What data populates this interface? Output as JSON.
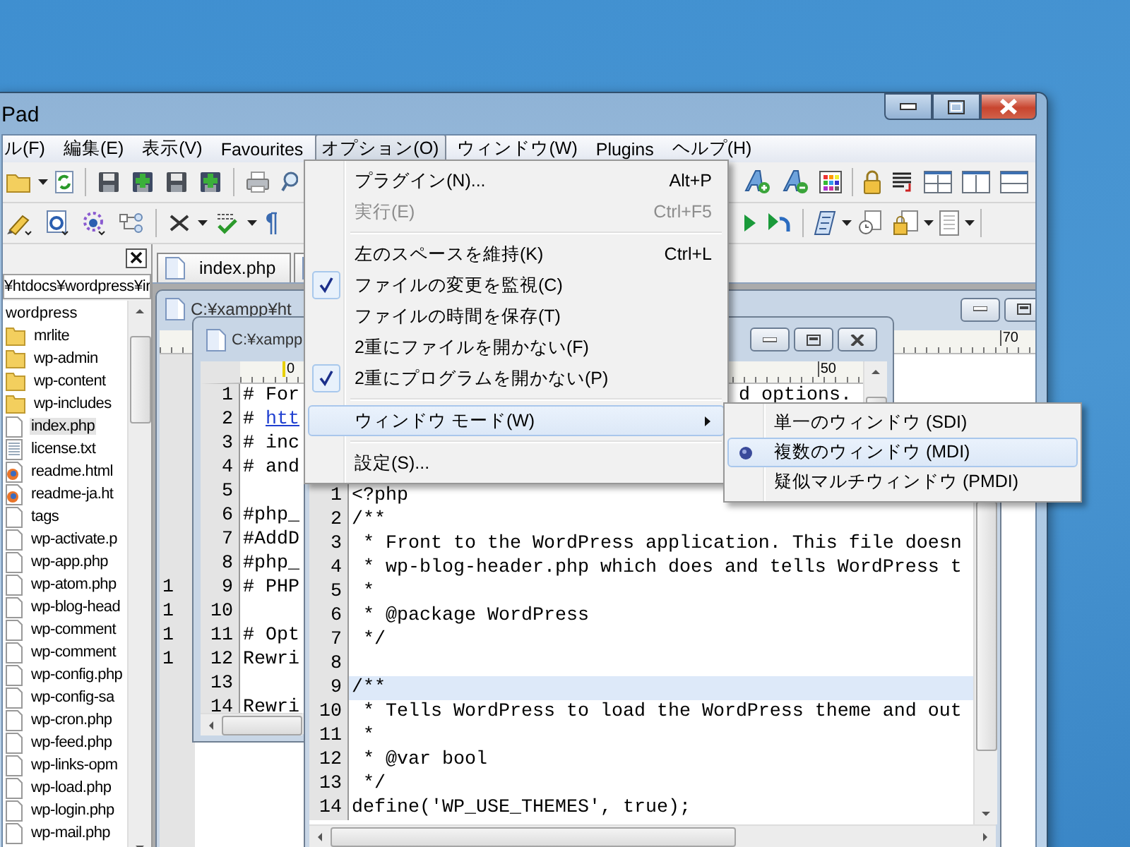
{
  "window": {
    "title": "Pad"
  },
  "menu_bar": [
    {
      "label": "ル(F)",
      "selected": false
    },
    {
      "label": "編集(E)",
      "selected": false
    },
    {
      "label": "表示(V)",
      "selected": false
    },
    {
      "label": "Favourites",
      "selected": false
    },
    {
      "label": "オプション(O)",
      "selected": true
    },
    {
      "label": "ウィンドウ(W)",
      "selected": false
    },
    {
      "label": "Plugins",
      "selected": false
    },
    {
      "label": "ヘルプ(H)",
      "selected": false
    }
  ],
  "options_menu": {
    "groups": [
      [
        {
          "label": "プラグイン(N)...",
          "shortcut": "Alt+P",
          "kind": "item",
          "checked": false,
          "disabled": false,
          "selected": false
        },
        {
          "label": "実行(E)",
          "shortcut": "Ctrl+F5",
          "kind": "item",
          "checked": false,
          "disabled": true,
          "selected": false
        }
      ],
      [
        {
          "label": "左のスペースを維持(K)",
          "shortcut": "Ctrl+L",
          "kind": "item",
          "checked": false,
          "disabled": false,
          "selected": false
        },
        {
          "label": "ファイルの変更を監視(C)",
          "kind": "item",
          "checked": true,
          "disabled": false,
          "selected": false
        },
        {
          "label": "ファイルの時間を保存(T)",
          "kind": "item",
          "checked": false,
          "disabled": false,
          "selected": false
        },
        {
          "label": "2重にファイルを開かない(F)",
          "kind": "item",
          "checked": false,
          "disabled": false,
          "selected": false
        },
        {
          "label": "2重にプログラムを開かない(P)",
          "kind": "item",
          "checked": true,
          "disabled": false,
          "selected": false
        }
      ],
      [
        {
          "label": "ウィンドウ モード(W)",
          "kind": "submenu",
          "checked": false,
          "disabled": false,
          "selected": true
        }
      ],
      [
        {
          "label": "設定(S)...",
          "kind": "item",
          "checked": false,
          "disabled": false,
          "selected": false
        }
      ]
    ]
  },
  "window_mode_submenu": [
    {
      "label": "単一のウィンドウ (SDI)",
      "selected": false
    },
    {
      "label": "複数のウィンドウ (MDI)",
      "selected": true
    },
    {
      "label": "疑似マルチウィンドウ (PMDI)",
      "selected": false
    }
  ],
  "file_panel": {
    "path": "¥htdocs¥wordpress¥ir",
    "tree": [
      {
        "label": "wordpress",
        "selected": false,
        "children": [
          {
            "label": "mrlite",
            "kind": "folder",
            "selected": false
          },
          {
            "label": "wp-admin",
            "kind": "folder",
            "selected": false
          },
          {
            "label": "wp-content",
            "kind": "folder",
            "selected": false
          },
          {
            "label": "wp-includes",
            "kind": "folder",
            "selected": false
          },
          {
            "label": "index.php",
            "kind": "file",
            "selected": true
          },
          {
            "label": "license.txt",
            "kind": "text",
            "selected": false
          },
          {
            "label": "readme.html",
            "kind": "browser",
            "selected": false
          },
          {
            "label": "readme-ja.ht",
            "kind": "browser",
            "selected": false
          },
          {
            "label": "tags",
            "kind": "file",
            "selected": false
          },
          {
            "label": "wp-activate.p",
            "kind": "file",
            "selected": false
          },
          {
            "label": "wp-app.php",
            "kind": "file",
            "selected": false
          },
          {
            "label": "wp-atom.php",
            "kind": "file",
            "selected": false
          },
          {
            "label": "wp-blog-head",
            "kind": "file",
            "selected": false
          },
          {
            "label": "wp-comment",
            "kind": "file",
            "selected": false
          },
          {
            "label": "wp-comment",
            "kind": "file",
            "selected": false
          },
          {
            "label": "wp-config.php",
            "kind": "file",
            "selected": false
          },
          {
            "label": "wp-config-sa",
            "kind": "file",
            "selected": false
          },
          {
            "label": "wp-cron.php",
            "kind": "file",
            "selected": false
          },
          {
            "label": "wp-feed.php",
            "kind": "file",
            "selected": false
          },
          {
            "label": "wp-links-opm",
            "kind": "file",
            "selected": false
          },
          {
            "label": "wp-load.php",
            "kind": "file",
            "selected": false
          },
          {
            "label": "wp-login.php",
            "kind": "file",
            "selected": false
          },
          {
            "label": "wp-mail.php",
            "kind": "file",
            "selected": false
          }
        ]
      }
    ]
  },
  "tabs": [
    {
      "label": "index.php"
    }
  ],
  "window_back": {
    "title": "C:¥xampp¥ht",
    "ruler": [
      "70"
    ],
    "gutter": [
      "1",
      "1",
      "1",
      "1"
    ]
  },
  "window_middle": {
    "title": "C:¥xampp",
    "ruler": [
      "0",
      "50"
    ],
    "lines": [
      {
        "number": "1",
        "text": "# For",
        "tail": "d options."
      },
      {
        "number": "2",
        "text": "# ",
        "link": "htt"
      },
      {
        "number": "3",
        "text": "# inc"
      },
      {
        "number": "4",
        "text": "# and"
      },
      {
        "number": "5"
      },
      {
        "number": "6",
        "text": "#php_"
      },
      {
        "number": "7",
        "text": "#AddD"
      },
      {
        "number": "8",
        "text": "#php_"
      },
      {
        "number": "9",
        "text": "# PHP"
      },
      {
        "number": "10"
      },
      {
        "number": "11",
        "text": "# Opt"
      },
      {
        "number": "12",
        "text": "Rewri"
      },
      {
        "number": "13"
      },
      {
        "number": "14",
        "text": "Rewri"
      }
    ]
  },
  "window_front": {
    "lines": [
      {
        "number": "1",
        "text": "<?php",
        "current": false
      },
      {
        "number": "2",
        "text": "/**",
        "current": false
      },
      {
        "number": "3",
        "text": " * Front to the WordPress application. This file doesn",
        "current": false
      },
      {
        "number": "4",
        "text": " * wp-blog-header.php which does and tells WordPress t",
        "current": false
      },
      {
        "number": "5",
        "text": " *",
        "current": false
      },
      {
        "number": "6",
        "text": " * @package WordPress",
        "current": false
      },
      {
        "number": "7",
        "text": " */",
        "current": false
      },
      {
        "number": "8",
        "current": false
      },
      {
        "number": "9",
        "text": "/**",
        "current": true
      },
      {
        "number": "10",
        "text": " * Tells WordPress to load the WordPress theme and out",
        "current": false
      },
      {
        "number": "11",
        "text": " *",
        "current": false
      },
      {
        "number": "12",
        "text": " * @var bool",
        "current": false
      },
      {
        "number": "13",
        "text": " */",
        "current": false
      },
      {
        "number": "14",
        "text": "define('WP_USE_THEMES', true);",
        "current": false
      }
    ]
  }
}
